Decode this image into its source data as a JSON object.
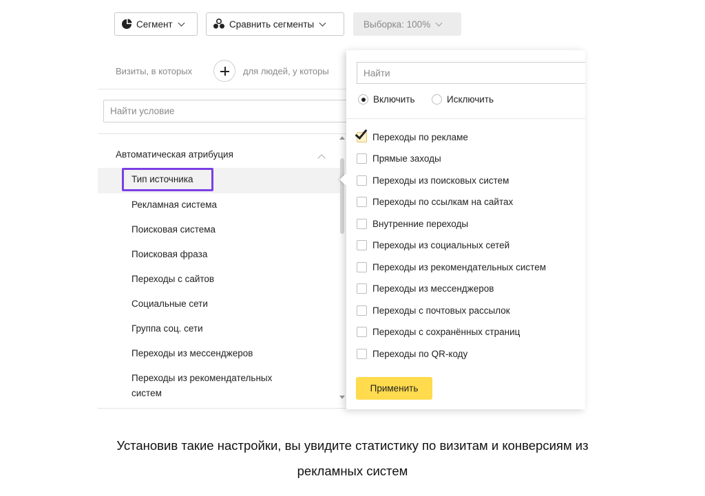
{
  "toolbar": {
    "segment_label": "Сегмент",
    "compare_label": "Сравнить сегменты",
    "sample_label": "Выборка: 100%"
  },
  "left_panel": {
    "visits_hint": "Визиты, в которых",
    "people_hint": "для людей, у которы",
    "condition_search_placeholder": "Найти условие",
    "group_title": "Автоматическая атрибуция",
    "items": [
      "Тип источника",
      "Рекламная система",
      "Поисковая система",
      "Поисковая фраза",
      "Переходы с сайтов",
      "Социальные сети",
      "Группа соц. сети",
      "Переходы из мессенджеров",
      "Переходы из рекомендательных",
      "систем"
    ]
  },
  "popup": {
    "search_placeholder": "Найти",
    "include_label": "Включить",
    "exclude_label": "Исключить",
    "options": [
      {
        "label": "Переходы по рекламе",
        "checked": true
      },
      {
        "label": "Прямые заходы",
        "checked": false
      },
      {
        "label": "Переходы из поисковых систем",
        "checked": false
      },
      {
        "label": "Переходы по ссылкам на сайтах",
        "checked": false
      },
      {
        "label": "Внутренние переходы",
        "checked": false
      },
      {
        "label": "Переходы из социальных сетей",
        "checked": false
      },
      {
        "label": "Переходы из рекомендательных систем",
        "checked": false
      },
      {
        "label": "Переходы из мессенджеров",
        "checked": false
      },
      {
        "label": "Переходы с почтовых рассылок",
        "checked": false
      },
      {
        "label": "Переходы с сохранённых страниц",
        "checked": false
      },
      {
        "label": "Переходы по QR-коду",
        "checked": false
      }
    ],
    "apply_label": "Применить"
  },
  "caption": {
    "line1": "Установив такие настройки, вы увидите статистику по визитам и конверсиям из",
    "line2": "рекламных систем"
  },
  "colors": {
    "highlight": "#7b3fe4",
    "apply_button": "#ffdb4d"
  }
}
